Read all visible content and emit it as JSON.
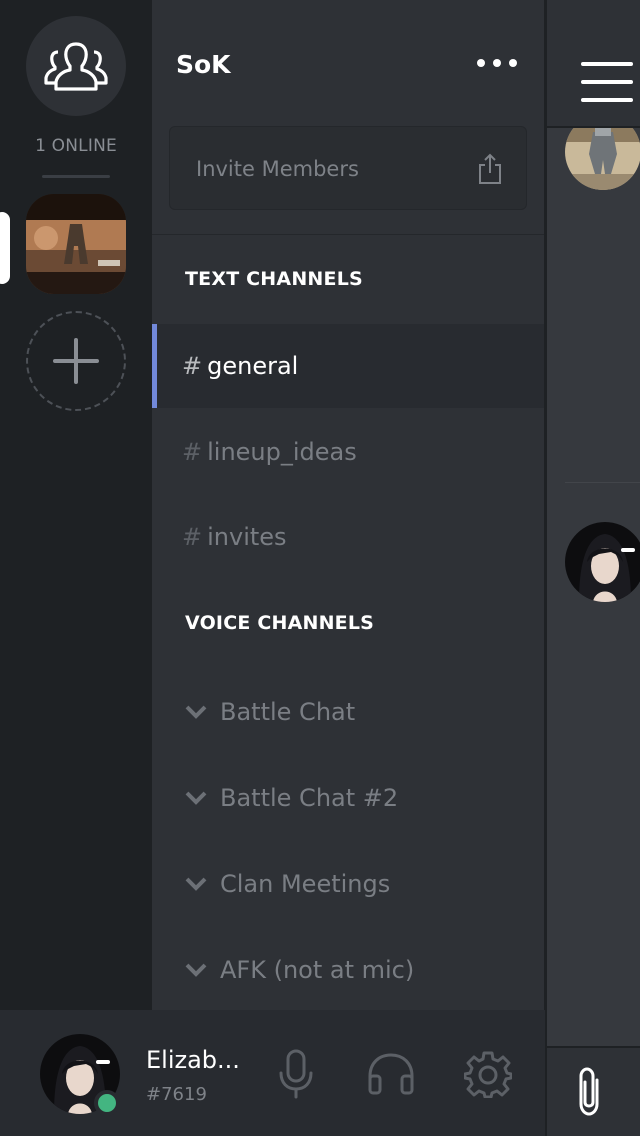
{
  "rail": {
    "online_count": "1 ONLINE"
  },
  "server": {
    "name": "SoK",
    "invite_label": "Invite Members"
  },
  "categories": {
    "text": "TEXT CHANNELS",
    "voice": "VOICE CHANNELS"
  },
  "text_channels": [
    {
      "hash": "#",
      "name": "general",
      "active": true
    },
    {
      "hash": "#",
      "name": "lineup_ideas",
      "active": false
    },
    {
      "hash": "#",
      "name": "invites",
      "active": false
    }
  ],
  "voice_channels": [
    {
      "name": "Battle Chat"
    },
    {
      "name": "Battle Chat #2"
    },
    {
      "name": "Clan Meetings"
    },
    {
      "name": "AFK (not at mic)"
    }
  ],
  "user": {
    "name": "Elizab...",
    "discriminator": "#7619",
    "status_color": "#43b581"
  },
  "colors": {
    "accent": "#7289da",
    "online": "#43b581"
  },
  "icons": {
    "friends": "friends-icon",
    "share": "share-icon",
    "add": "plus-icon",
    "mic": "microphone-icon",
    "headphones": "headphones-icon",
    "settings": "gear-icon",
    "menu": "hamburger-icon",
    "attach": "paperclip-icon"
  }
}
